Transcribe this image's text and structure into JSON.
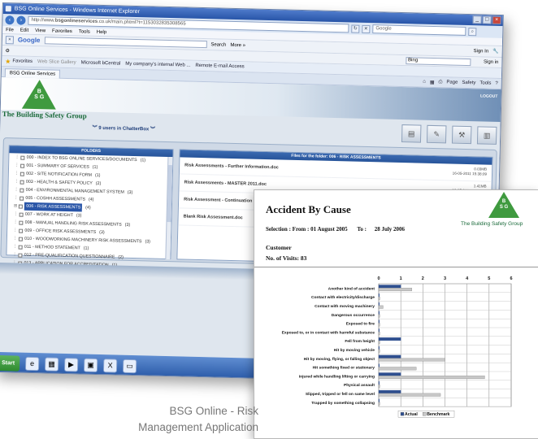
{
  "browser": {
    "title": "BSG Online Services - Windows Internet Explorer",
    "url_prefix": "http://www.",
    "url_host": "bsgonlineservices",
    "url_rest": ".co.uk/main.phtml?t=1153032835308565",
    "search_placeholder": "Google",
    "menu": [
      "File",
      "Edit",
      "View",
      "Favorites",
      "Tools",
      "Help"
    ],
    "google_logo": "Google",
    "google_search_label": "Search",
    "google_more": "More »",
    "google_signin": "Sign In",
    "bing_label": "Bing",
    "sign_in": "Sign in",
    "favorites_label": "Favorites",
    "favorites_items": [
      "Web Slice Gallery",
      "Microsoft bCentral",
      "My company's internal Web ...",
      "Remote E-mail Access"
    ],
    "tab_label": "BSG Online Services",
    "cmd_items": [
      "Page",
      "Safety",
      "Tools"
    ]
  },
  "site": {
    "logo_letters": "B\nS G",
    "org_name": "The Building Safety Group",
    "logout_label": "LOGOUT",
    "chatter": "9 users in ChatterBox",
    "folders_header": "FOLDERS",
    "folders": [
      {
        "label": "000 - INDEX TO BSG ONLINE SERVICES/DOCUMENTS",
        "count": "(1)"
      },
      {
        "label": "001 - SUMMARY OF SERVICES",
        "count": "(1)"
      },
      {
        "label": "002 - SITE NOTIFICATION FORM",
        "count": "(1)"
      },
      {
        "label": "003 - HEALTH & SAFETY POLICY",
        "count": "(2)"
      },
      {
        "label": "004 - ENVIRONMENTAL MANAGEMENT SYSTEM",
        "count": "(3)"
      },
      {
        "label": "005 - COSHH ASSESSMENTS",
        "count": "(4)"
      },
      {
        "label": "006 - RISK ASSESSMENTS",
        "count": "(4)",
        "selected": true
      },
      {
        "label": "007 - WORK AT HEIGHT",
        "count": "(3)"
      },
      {
        "label": "008 - MANUAL HANDLING RISK ASSESSMENTS",
        "count": "(3)"
      },
      {
        "label": "009 - OFFICE RISK ASSESSMENTS",
        "count": "(3)"
      },
      {
        "label": "010 - WOODWORKING MACHINERY RISK ASSESSMENTS",
        "count": "(3)"
      },
      {
        "label": "011 - METHOD STATEMENT",
        "count": "(1)"
      },
      {
        "label": "012 - PRE-QUALIFICATION QUESTIONNAIRE",
        "count": "(2)"
      },
      {
        "label": "013 - APPLICATION FOR ACCREDITATION",
        "count": "(1)"
      }
    ],
    "files_header": "Files for the folder: 006 - RISK ASSESSMENTS",
    "files": [
      {
        "name": "Risk Assessments - Further Information.doc",
        "size": "0.03MB",
        "date": "16-05-2011 15:38:09"
      },
      {
        "name": "Risk Assessments - MASTER 2011.doc",
        "size": "1.41MB",
        "date": "16-05-2011 15:37:53"
      },
      {
        "name": "Risk Assessment - Continuation Page.doc",
        "size": "0.03MB",
        "date": "08-03-2011 11:40:48"
      },
      {
        "name": "Blank Risk Assessment.doc",
        "size": "",
        "date": ""
      }
    ],
    "start_label": "Start"
  },
  "report": {
    "title": "Accident By Cause",
    "selection_label": "Selection :",
    "from_label": "From :",
    "from_date": "01 August 2005",
    "to_label": "To :",
    "to_date": "28 July 2006",
    "customer_label": "Customer",
    "visits_label": "No. of Visits:",
    "visits_value": "83",
    "logo_letters": "B\nS G",
    "logo_name": "The Building Safety Group"
  },
  "chart_data": {
    "type": "bar",
    "orientation": "horizontal",
    "categories": [
      "Another kind of accident",
      "Contact with electricity/discharge",
      "Contact with moving machinery",
      "Dangerous occurrence",
      "Exposed to fire",
      "Exposed to, or in contact with harmful substance",
      "Fell from height",
      "Hit by moving vehicle",
      "Hit by moving, flying, or falling object",
      "Hit something fixed or stationary",
      "Injured while handling lifting or carrying",
      "Physical assault",
      "Slipped, tripped or fell on same level",
      "Trapped by something collapsing"
    ],
    "series": [
      {
        "name": "Actual",
        "values": [
          1,
          0,
          0,
          0,
          0,
          0,
          1,
          0,
          1,
          0,
          1,
          0,
          1,
          0
        ],
        "color": "#2f4f8f"
      },
      {
        "name": "Benchmark",
        "values": [
          1.5,
          0.05,
          0.2,
          0.05,
          0.05,
          0.05,
          0.05,
          0.05,
          3.0,
          1.7,
          4.8,
          0.05,
          2.8,
          0.05
        ],
        "color": "#c8c8c8"
      }
    ],
    "xlim": [
      0,
      6
    ],
    "xticks": [
      "0",
      "1",
      "2",
      "3",
      "4",
      "5",
      "6"
    ],
    "grid": true,
    "legend": "bottom-center"
  },
  "caption": [
    "BSG Online - Risk",
    "Management Application"
  ]
}
